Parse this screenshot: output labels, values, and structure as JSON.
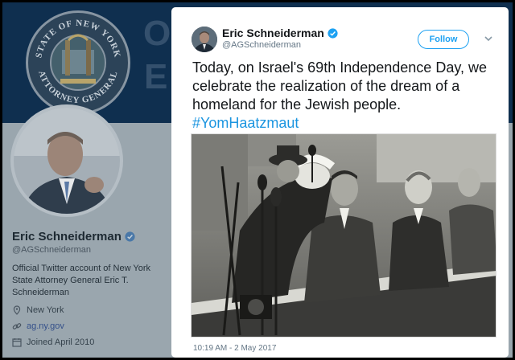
{
  "background_profile": {
    "banner_text_line1": "Off",
    "banner_text_line2": "E",
    "seal": {
      "top_text": "STATE OF NEW YORK",
      "bottom_text": "ATTORNEY GENERAL"
    },
    "name": "Eric Schneiderman",
    "handle": "@AGSchneiderman",
    "bio": "Official Twitter account of New York State Attorney General Eric T. Schneiderman",
    "location": "New York",
    "url": "ag.ny.gov",
    "joined": "Joined April 2010"
  },
  "tweet": {
    "author_name": "Eric Schneiderman",
    "author_handle": "@AGSchneiderman",
    "follow_label": "Follow",
    "text": "Today, on Israel's 69th Independence Day, we celebrate the realization of the dream of a homeland for the Jewish people.",
    "hashtag": "#YomHaatzmaut",
    "timestamp": "10:19 AM - 2 May 2017"
  },
  "icons": {
    "verified": "verified-badge-icon",
    "caret": "chevron-down-icon",
    "location": "location-pin-icon",
    "link": "link-icon",
    "calendar": "calendar-icon"
  },
  "colors": {
    "twitter_blue": "#1da1f2",
    "hashtag_blue": "#1b95e0",
    "banner_navy": "#0f2f4f",
    "overlay_grey": "#9aa6ae"
  }
}
